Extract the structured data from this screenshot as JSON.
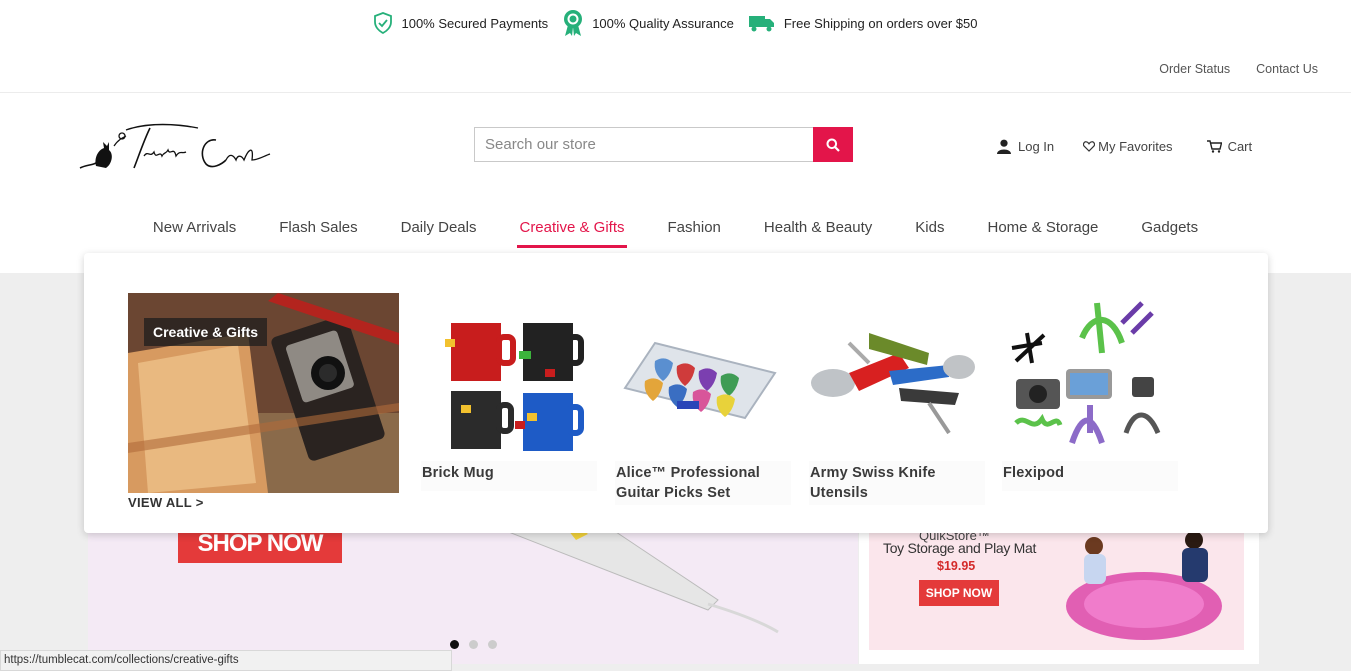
{
  "trust": [
    {
      "icon": "shield-check-icon",
      "label": "100% Secured Payments"
    },
    {
      "icon": "award-badge-icon",
      "label": "100% Quality Assurance"
    },
    {
      "icon": "delivery-truck-icon",
      "label": "Free Shipping on orders over $50"
    }
  ],
  "utility": {
    "order_status": "Order Status",
    "contact": "Contact Us"
  },
  "brand": {
    "logo_text": "Tumble Cat",
    "accent": "#e3154a"
  },
  "search": {
    "placeholder": "Search our store"
  },
  "account": {
    "login": "Log In",
    "favorites": "My Favorites",
    "cart": "Cart"
  },
  "nav": {
    "items": [
      "New Arrivals",
      "Flash Sales",
      "Daily Deals",
      "Creative & Gifts",
      "Fashion",
      "Health & Beauty",
      "Kids",
      "Home & Storage",
      "Gadgets"
    ],
    "active": "Creative & Gifts"
  },
  "mega": {
    "feature_label": "Creative & Gifts",
    "view_all": "VIEW ALL >",
    "products": [
      {
        "name": "Brick Mug"
      },
      {
        "name": "Alice™ Professional Guitar Picks Set"
      },
      {
        "name": "Army Swiss Knife Utensils"
      },
      {
        "name": "Flexipod"
      }
    ]
  },
  "hero": {
    "main_cta": "SHOP NOW",
    "side": {
      "brand": "QuikStore™",
      "title": "Toy Storage and Play Mat",
      "price": "$19.95",
      "cta": "SHOP NOW"
    },
    "slides": 3,
    "active_slide": 1
  },
  "status_url": "https://tumblecat.com/collections/creative-gifts"
}
